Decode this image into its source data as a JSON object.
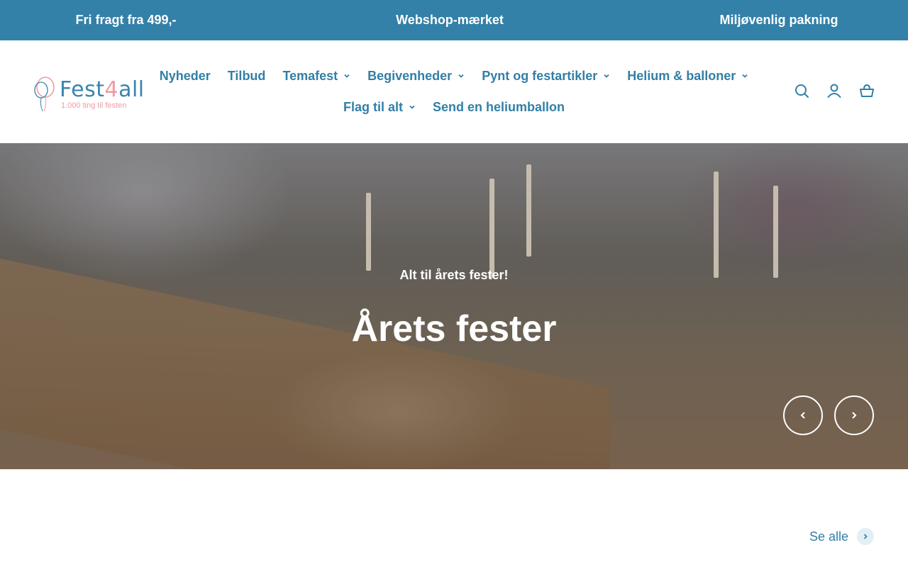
{
  "announcement": {
    "items": [
      "Fri fragt fra 499,-",
      "Webshop-mærket",
      "Miljøvenlig pakning"
    ]
  },
  "logo": {
    "brand_part1": "Fest",
    "brand_four": "4",
    "brand_part2": "all",
    "tagline": "1.000 ting til festen"
  },
  "nav": {
    "row1": [
      {
        "label": "Nyheder",
        "dropdown": false
      },
      {
        "label": "Tilbud",
        "dropdown": false
      },
      {
        "label": "Temafest",
        "dropdown": true
      },
      {
        "label": "Begivenheder",
        "dropdown": true
      },
      {
        "label": "Pynt og festartikler",
        "dropdown": true
      },
      {
        "label": "Helium & balloner",
        "dropdown": true
      }
    ],
    "row2": [
      {
        "label": "Flag til alt",
        "dropdown": true
      },
      {
        "label": "Send en heliumballon",
        "dropdown": false
      }
    ]
  },
  "header_icons": [
    "search-icon",
    "account-icon",
    "cart-icon"
  ],
  "hero": {
    "subtitle": "Alt til årets fester!",
    "title": "Årets fester"
  },
  "collection": {
    "see_all": "Se alle"
  },
  "colors": {
    "brand_blue": "#3380a8",
    "text_blue": "#327fa6",
    "logo_pink": "#ef9aa3"
  }
}
